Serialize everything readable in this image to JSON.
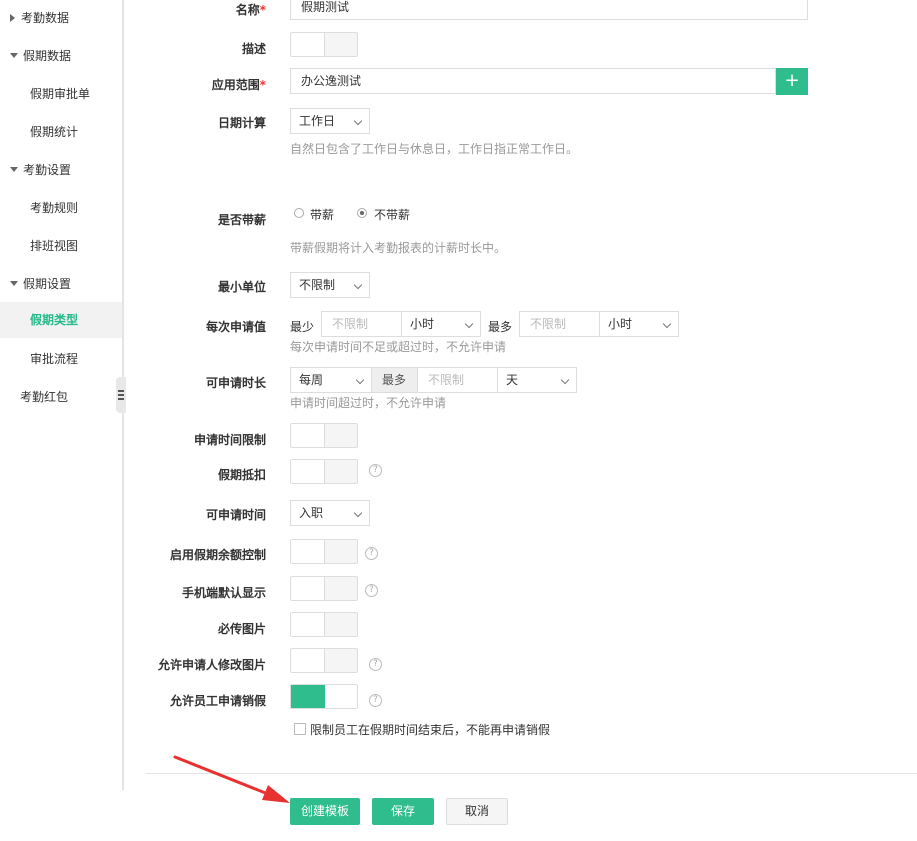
{
  "sidebar": {
    "items": [
      {
        "label": "考勤数据",
        "type": "group",
        "caret": "right"
      },
      {
        "label": "假期数据",
        "type": "group",
        "caret": "down"
      },
      {
        "label": "假期审批单",
        "type": "sub"
      },
      {
        "label": "假期统计",
        "type": "sub"
      },
      {
        "label": "考勤设置",
        "type": "group",
        "caret": "down"
      },
      {
        "label": "考勤规则",
        "type": "sub"
      },
      {
        "label": "排班视图",
        "type": "sub"
      },
      {
        "label": "假期设置",
        "type": "group",
        "caret": "down"
      },
      {
        "label": "假期类型",
        "type": "sub",
        "active": true
      },
      {
        "label": "审批流程",
        "type": "sub"
      },
      {
        "label": "考勤红包",
        "type": "plain"
      }
    ]
  },
  "form": {
    "name": {
      "label": "名称",
      "required": "*",
      "value": "假期测试"
    },
    "description": {
      "label": "描述"
    },
    "scope": {
      "label": "应用范围",
      "required": "*",
      "value": "办公逸测试",
      "add_icon": "+"
    },
    "date_calc": {
      "label": "日期计算",
      "value": "工作日",
      "hint": "自然日包含了工作日与休息日，工作日指正常工作日。"
    },
    "paid": {
      "label": "是否带薪",
      "option_paid": "带薪",
      "option_unpaid": "不带薪",
      "selected": "不带薪",
      "hint": "带薪假期将计入考勤报表的计薪时长中。"
    },
    "min_unit": {
      "label": "最小单位",
      "value": "不限制"
    },
    "per_request": {
      "label": "每次申请值",
      "min_label": "最少",
      "min_placeholder": "不限制",
      "min_unit": "小时",
      "max_label": "最多",
      "max_placeholder": "不限制",
      "max_unit": "小时",
      "hint": "每次申请时间不足或超过时，不允许申请"
    },
    "duration": {
      "label": "可申请时长",
      "period": "每周",
      "max_label": "最多",
      "max_placeholder": "不限制",
      "unit": "天",
      "hint": "申请时间超过时，不允许申请"
    },
    "time_limit": {
      "label": "申请时间限制"
    },
    "deduct": {
      "label": "假期抵扣"
    },
    "apply_time": {
      "label": "可申请时间",
      "value": "入职"
    },
    "balance_control": {
      "label": "启用假期余额控制"
    },
    "mobile_default": {
      "label": "手机端默认显示"
    },
    "require_image": {
      "label": "必传图片"
    },
    "modify_image": {
      "label": "允许申请人修改图片"
    },
    "cancel_leave": {
      "label": "允许员工申请销假",
      "on": true
    },
    "cancel_restrict": {
      "label": "限制员工在假期时间结束后，不能再申请销假"
    }
  },
  "help_icon": "?",
  "colors": {
    "accent": "#2fbd8e",
    "required": "#e33",
    "arrow": "#e8322f"
  },
  "footer": {
    "create_template": "创建模板",
    "save": "保存",
    "cancel": "取消"
  }
}
